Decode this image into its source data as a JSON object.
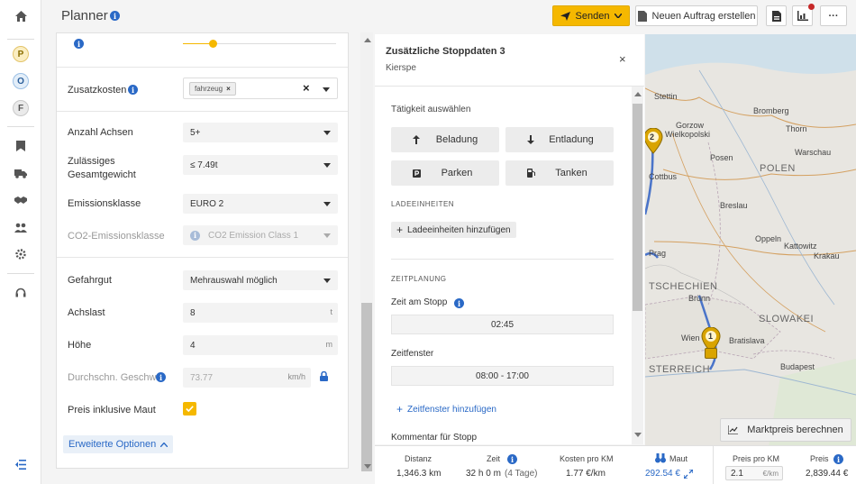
{
  "app": {
    "title": "Planner"
  },
  "rail": {
    "letters": [
      "P",
      "O",
      "F"
    ]
  },
  "toolbar": {
    "send_label": "Senden",
    "new_order_label": "Neuen Auftrag erstellen",
    "more_label": "···"
  },
  "form": {
    "surcharges": {
      "label": "Zusatzkosten",
      "chip": "fahrzeug"
    },
    "axles": {
      "label": "Anzahl Achsen",
      "value": "5+"
    },
    "gross_weight": {
      "label_line1": "Zulässiges",
      "label_line2": "Gesamtgewicht",
      "value": "≤ 7.49t"
    },
    "emission_class": {
      "label": "Emissionsklasse",
      "value": "EURO 2"
    },
    "co2_class": {
      "label": "CO2-Emissionsklasse",
      "value": "CO2 Emission Class 1"
    },
    "hazmat": {
      "label": "Gefahrgut",
      "value": "Mehrauswahl möglich"
    },
    "axle_load": {
      "label": "Achslast",
      "value": "8",
      "unit": "t"
    },
    "height": {
      "label": "Höhe",
      "value": "4",
      "unit": "m"
    },
    "avg_speed": {
      "label": "Durchschn. Geschw.",
      "value": "73.77",
      "unit": "km/h"
    },
    "price_incl_toll": {
      "label": "Preis inklusive Maut",
      "checked": true
    },
    "advanced_label": "Erweiterte Optionen"
  },
  "stop_panel": {
    "title": "Zusätzliche Stoppdaten 3",
    "subtitle": "Kierspe",
    "activity_heading": "Tätigkeit auswählen",
    "activities": [
      "Beladung",
      "Entladung",
      "Parken",
      "Tanken"
    ],
    "load_units_heading": "LADEEINHEITEN",
    "add_load_units": "Ladeeinheiten hinzufügen",
    "time_planning_heading": "ZEITPLANUNG",
    "stop_time_label": "Zeit am Stopp",
    "stop_time_value": "02:45",
    "time_window_label": "Zeitfenster",
    "time_window_value": "08:00 - 17:00",
    "add_time_window": "Zeitfenster hinzufügen",
    "comment_label": "Kommentar für Stopp"
  },
  "map": {
    "labels": [
      "Stettin",
      "Gorzow",
      "Wielkopolski",
      "Bromberg",
      "Thorn",
      "Warschau",
      "Posen",
      "POLEN",
      "Cottbus",
      "Breslau",
      "Oppeln",
      "Kattowitz",
      "Krakau",
      "Prag",
      "TSCHECHIEN",
      "Brünn",
      "SLOWAKEI",
      "Wien",
      "Bratislava",
      "Budapest",
      "STERREICH"
    ],
    "markers": [
      "2",
      "1"
    ],
    "market_price_button": "Marktpreis berechnen"
  },
  "summary": {
    "distance": {
      "label": "Distanz",
      "value": "1,346.3 km"
    },
    "time": {
      "label": "Zeit",
      "value": "32 h 0 m",
      "extra": "(4 Tage)"
    },
    "cost_per_km": {
      "label": "Kosten pro KM",
      "value": "1.77 €/km"
    },
    "toll": {
      "label": "Maut",
      "value": "292.54 €"
    },
    "price_per_km": {
      "label": "Preis pro KM",
      "value": "2.1",
      "unit": "€/km"
    },
    "price": {
      "label": "Preis",
      "value": "2,839.44 €"
    }
  }
}
